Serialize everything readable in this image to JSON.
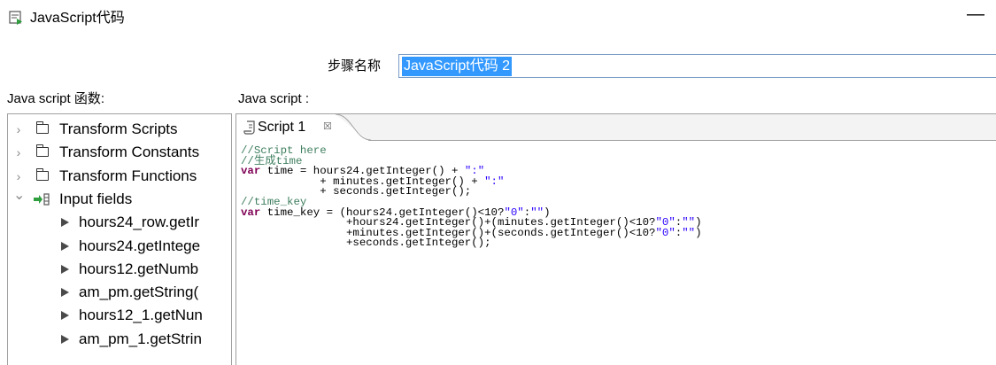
{
  "window": {
    "title": "JavaScript代码",
    "minimize_glyph": "—"
  },
  "step": {
    "label": "步骤名称",
    "value": "JavaScript代码 2"
  },
  "functions_panel": {
    "label": "Java script 函数:",
    "tree": [
      {
        "label": "Transform Scripts",
        "type": "folder",
        "expanded": false
      },
      {
        "label": "Transform Constants",
        "type": "folder",
        "expanded": false
      },
      {
        "label": "Transform Functions",
        "type": "folder",
        "expanded": false
      },
      {
        "label": "Input fields",
        "type": "input-fields",
        "expanded": true
      },
      {
        "label": "hours24_row.getIr",
        "type": "leaf"
      },
      {
        "label": "hours24.getIntege",
        "type": "leaf"
      },
      {
        "label": "hours12.getNumb",
        "type": "leaf"
      },
      {
        "label": "am_pm.getString(",
        "type": "leaf"
      },
      {
        "label": "hours12_1.getNun",
        "type": "leaf"
      },
      {
        "label": "am_pm_1.getStrin",
        "type": "leaf"
      }
    ]
  },
  "editor": {
    "label": "Java script :",
    "tab": {
      "label": "Script 1",
      "close_glyph": "☒"
    },
    "code_lines": [
      [
        {
          "t": "//Script here",
          "c": "cm"
        }
      ],
      [
        {
          "t": "//生成time",
          "c": "cm"
        }
      ],
      [
        {
          "t": "var",
          "c": "kw"
        },
        {
          "t": " time = hours24.getInteger() + ",
          "c": ""
        },
        {
          "t": "\":\"",
          "c": "st"
        }
      ],
      [
        {
          "t": "            + minutes.getInteger() + ",
          "c": ""
        },
        {
          "t": "\":\"",
          "c": "st"
        }
      ],
      [
        {
          "t": "            + seconds.getInteger();",
          "c": ""
        }
      ],
      [
        {
          "t": "//time_key",
          "c": "cm"
        }
      ],
      [
        {
          "t": "var",
          "c": "kw"
        },
        {
          "t": " time_key = (hours24.getInteger()<10?",
          "c": ""
        },
        {
          "t": "\"0\"",
          "c": "st"
        },
        {
          "t": ":",
          "c": ""
        },
        {
          "t": "\"\"",
          "c": "st"
        },
        {
          "t": ")",
          "c": ""
        }
      ],
      [
        {
          "t": "                +hours24.getInteger()+(minutes.getInteger()<10?",
          "c": ""
        },
        {
          "t": "\"0\"",
          "c": "st"
        },
        {
          "t": ":",
          "c": ""
        },
        {
          "t": "\"\"",
          "c": "st"
        },
        {
          "t": ")",
          "c": ""
        }
      ],
      [
        {
          "t": "                +minutes.getInteger()+(seconds.getInteger()<10?",
          "c": ""
        },
        {
          "t": "\"0\"",
          "c": "st"
        },
        {
          "t": ":",
          "c": ""
        },
        {
          "t": "\"\"",
          "c": "st"
        },
        {
          "t": ")",
          "c": ""
        }
      ],
      [
        {
          "t": "                +seconds.getInteger();",
          "c": ""
        }
      ]
    ]
  },
  "colors": {
    "selection": "#3399ff",
    "comment": "#3f7f5f",
    "keyword": "#7f0055",
    "string": "#2a00ff"
  }
}
